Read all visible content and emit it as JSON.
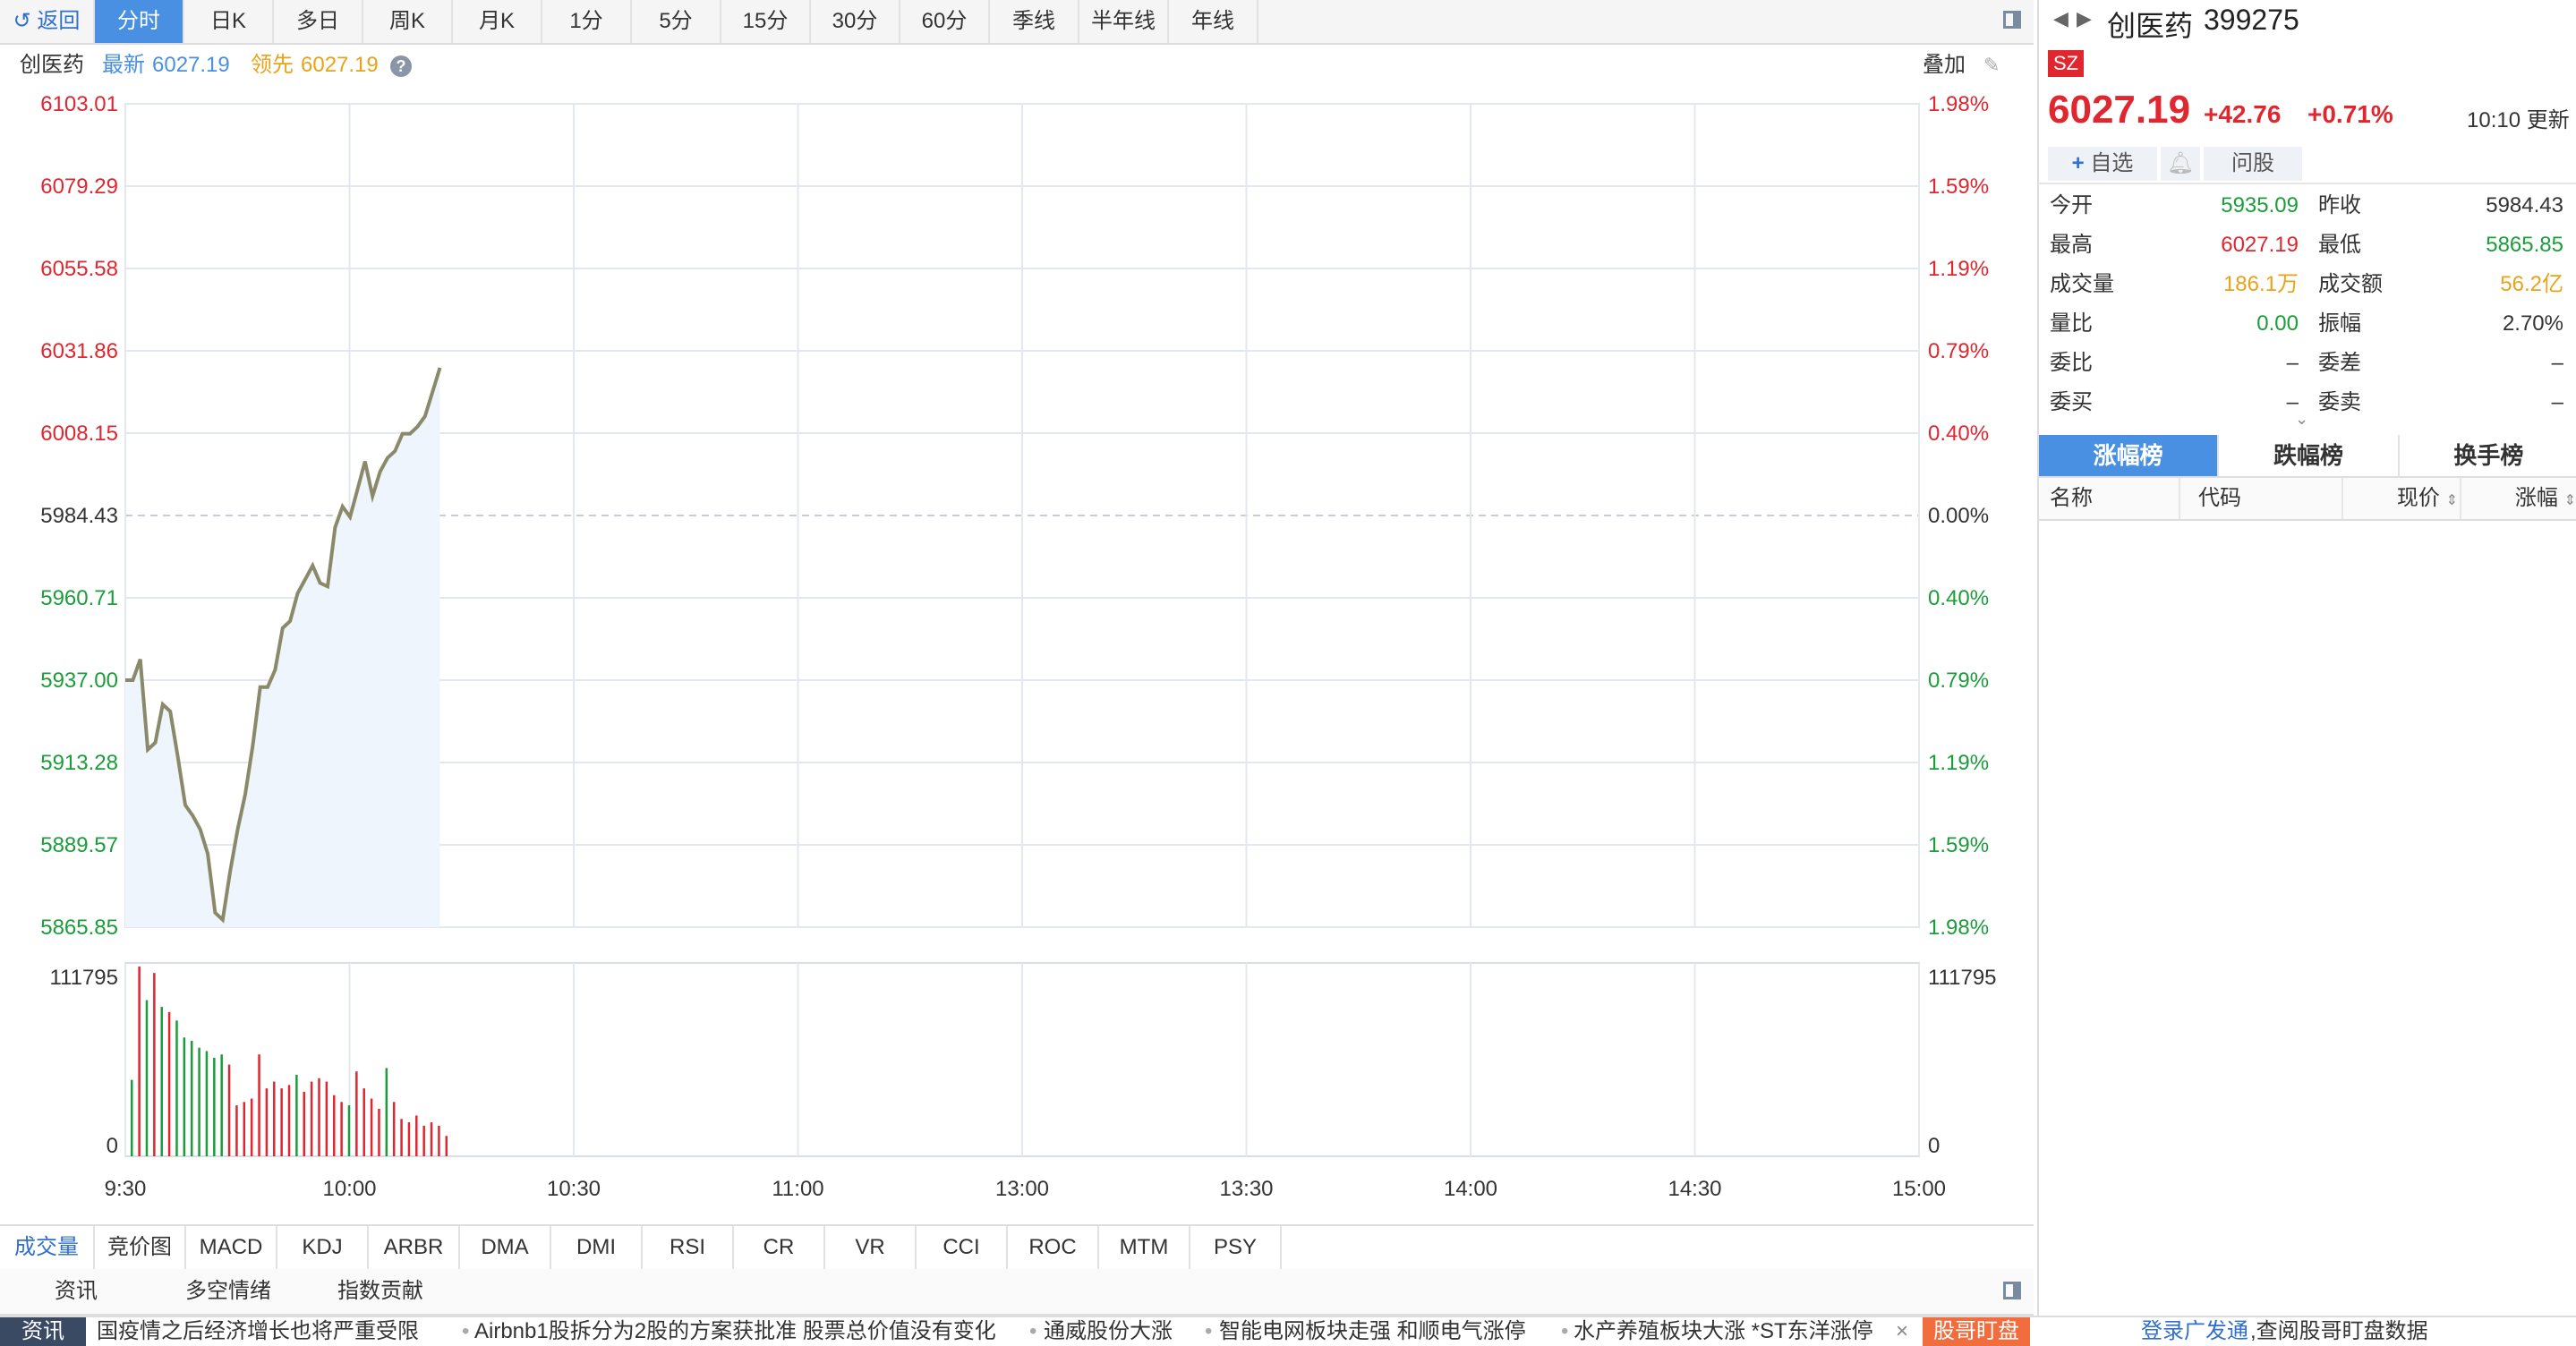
{
  "toolbar": {
    "back_label": "返回",
    "periods": [
      "分时",
      "日K",
      "多日",
      "周K",
      "月K",
      "1分",
      "5分",
      "15分",
      "30分",
      "60分",
      "季线",
      "半年线",
      "年线"
    ],
    "active_period": "分时"
  },
  "info": {
    "name": "创医药",
    "latest_label": "最新",
    "latest_value": "6027.19",
    "lead_label": "领先",
    "lead_value": "6027.19",
    "overlay_label": "叠加"
  },
  "chart_data": {
    "type": "line",
    "title": "",
    "price_ticks_left": [
      "6103.01",
      "6079.29",
      "6055.58",
      "6031.86",
      "6008.15",
      "5984.43",
      "5960.71",
      "5937.00",
      "5913.28",
      "5889.57",
      "5865.85"
    ],
    "percent_ticks_right": [
      "1.98%",
      "1.59%",
      "1.19%",
      "0.79%",
      "0.40%",
      "0.00%",
      "0.40%",
      "0.79%",
      "1.19%",
      "1.59%",
      "1.98%"
    ],
    "prev_close": 5984.43,
    "ylim": [
      5865.85,
      6103.01
    ],
    "x_ticks": [
      "9:30",
      "10:00",
      "10:30",
      "11:00",
      "13:00",
      "13:30",
      "14:00",
      "14:30",
      "15:00"
    ],
    "price_series": [
      5937.0,
      5937.0,
      5943.0,
      5917.0,
      5919.0,
      5930.0,
      5928.0,
      5915.0,
      5901.0,
      5898.0,
      5894.0,
      5887.0,
      5870.0,
      5868.0,
      5882.0,
      5894.0,
      5904.0,
      5918.0,
      5935.0,
      5935.0,
      5940.0,
      5952.0,
      5954.0,
      5962.0,
      5966.0,
      5970.0,
      5965.0,
      5964.0,
      5981.0,
      5987.0,
      5984.0,
      5992.0,
      6000.0,
      5990.0,
      5997.0,
      6001.0,
      6003.0,
      6008.0,
      6008.0,
      6010.0,
      6013.0,
      6020.0,
      6027.0
    ],
    "volume_ticks": [
      "111795",
      "0"
    ],
    "volume_max": 111795,
    "volume_series": [
      {
        "v": 45000,
        "c": "green"
      },
      {
        "v": 111795,
        "c": "red"
      },
      {
        "v": 92000,
        "c": "green"
      },
      {
        "v": 108000,
        "c": "red"
      },
      {
        "v": 88000,
        "c": "green"
      },
      {
        "v": 85000,
        "c": "red"
      },
      {
        "v": 80000,
        "c": "green"
      },
      {
        "v": 70000,
        "c": "green"
      },
      {
        "v": 68000,
        "c": "green"
      },
      {
        "v": 64000,
        "c": "green"
      },
      {
        "v": 62000,
        "c": "green"
      },
      {
        "v": 58000,
        "c": "green"
      },
      {
        "v": 60000,
        "c": "green"
      },
      {
        "v": 54000,
        "c": "red"
      },
      {
        "v": 30000,
        "c": "red"
      },
      {
        "v": 32000,
        "c": "red"
      },
      {
        "v": 34000,
        "c": "red"
      },
      {
        "v": 60000,
        "c": "red"
      },
      {
        "v": 40000,
        "c": "red"
      },
      {
        "v": 44000,
        "c": "red"
      },
      {
        "v": 40000,
        "c": "red"
      },
      {
        "v": 42000,
        "c": "red"
      },
      {
        "v": 48000,
        "c": "green"
      },
      {
        "v": 38000,
        "c": "red"
      },
      {
        "v": 44000,
        "c": "red"
      },
      {
        "v": 46000,
        "c": "red"
      },
      {
        "v": 44000,
        "c": "red"
      },
      {
        "v": 36000,
        "c": "red"
      },
      {
        "v": 32000,
        "c": "red"
      },
      {
        "v": 30000,
        "c": "green"
      },
      {
        "v": 50000,
        "c": "red"
      },
      {
        "v": 40000,
        "c": "red"
      },
      {
        "v": 34000,
        "c": "red"
      },
      {
        "v": 28000,
        "c": "red"
      },
      {
        "v": 52000,
        "c": "green"
      },
      {
        "v": 32000,
        "c": "red"
      },
      {
        "v": 22000,
        "c": "red"
      },
      {
        "v": 20000,
        "c": "red"
      },
      {
        "v": 24000,
        "c": "red"
      },
      {
        "v": 18000,
        "c": "red"
      },
      {
        "v": 20000,
        "c": "red"
      },
      {
        "v": 18000,
        "c": "red"
      },
      {
        "v": 12000,
        "c": "red"
      }
    ]
  },
  "indicators": [
    "成交量",
    "竞价图",
    "MACD",
    "KDJ",
    "ARBR",
    "DMA",
    "DMI",
    "RSI",
    "CR",
    "VR",
    "CCI",
    "ROC",
    "MTM",
    "PSY"
  ],
  "active_indicator": "成交量",
  "news_tabs": [
    "资讯",
    "多空情绪",
    "指数贡献"
  ],
  "ticker": {
    "label": "资讯",
    "items": [
      "国疫情之后经济增长也将严重受限",
      "Airbnb1股拆分为2股的方案获批准 股票总价值没有变化",
      "通威股份大涨",
      "智能电网板块走强 和顺电气涨停",
      "水产养殖板块大涨 *ST东洋涨停"
    ],
    "close_symbol": "×",
    "promo_badge": "股哥盯盘",
    "promo_link": "登录广发通",
    "promo_text": ",查阅股哥盯盘数据"
  },
  "quote": {
    "name": "创医药",
    "code": "399275",
    "market": "SZ",
    "price": "6027.19",
    "change": "+42.76",
    "change_pct": "+0.71%",
    "update_time": "10:10 更新",
    "add_watch": "自选",
    "ask_label": "问股",
    "fields": [
      {
        "l1": "今开",
        "v1": "5935.09",
        "c1": "#1a9d3a",
        "l2": "昨收",
        "v2": "5984.43",
        "c2": "#333333"
      },
      {
        "l1": "最高",
        "v1": "6027.19",
        "c1": "#e0262f",
        "l2": "最低",
        "v2": "5865.85",
        "c2": "#1a9d3a"
      },
      {
        "l1": "成交量",
        "v1": "186.1万",
        "c1": "#e8a317",
        "l2": "成交额",
        "v2": "56.2亿",
        "c2": "#e8a317"
      },
      {
        "l1": "量比",
        "v1": "0.00",
        "c1": "#1a9d3a",
        "l2": "振幅",
        "v2": "2.70%",
        "c2": "#333333"
      },
      {
        "l1": "委比",
        "v1": "–",
        "c1": "#333333",
        "l2": "委差",
        "v2": "–",
        "c2": "#333333"
      },
      {
        "l1": "委买",
        "v1": "–",
        "c1": "#333333",
        "l2": "委卖",
        "v2": "–",
        "c2": "#333333"
      }
    ],
    "rank_tabs": [
      "涨幅榜",
      "跌幅榜",
      "换手榜"
    ],
    "rank_headers": [
      "名称",
      "代码",
      "现价",
      "涨幅"
    ]
  },
  "colors": {
    "up": "#e0262f",
    "down": "#1a9d3a",
    "accent": "#4a90e2",
    "line": "#8a8a6a",
    "area": "#eef5fd"
  }
}
